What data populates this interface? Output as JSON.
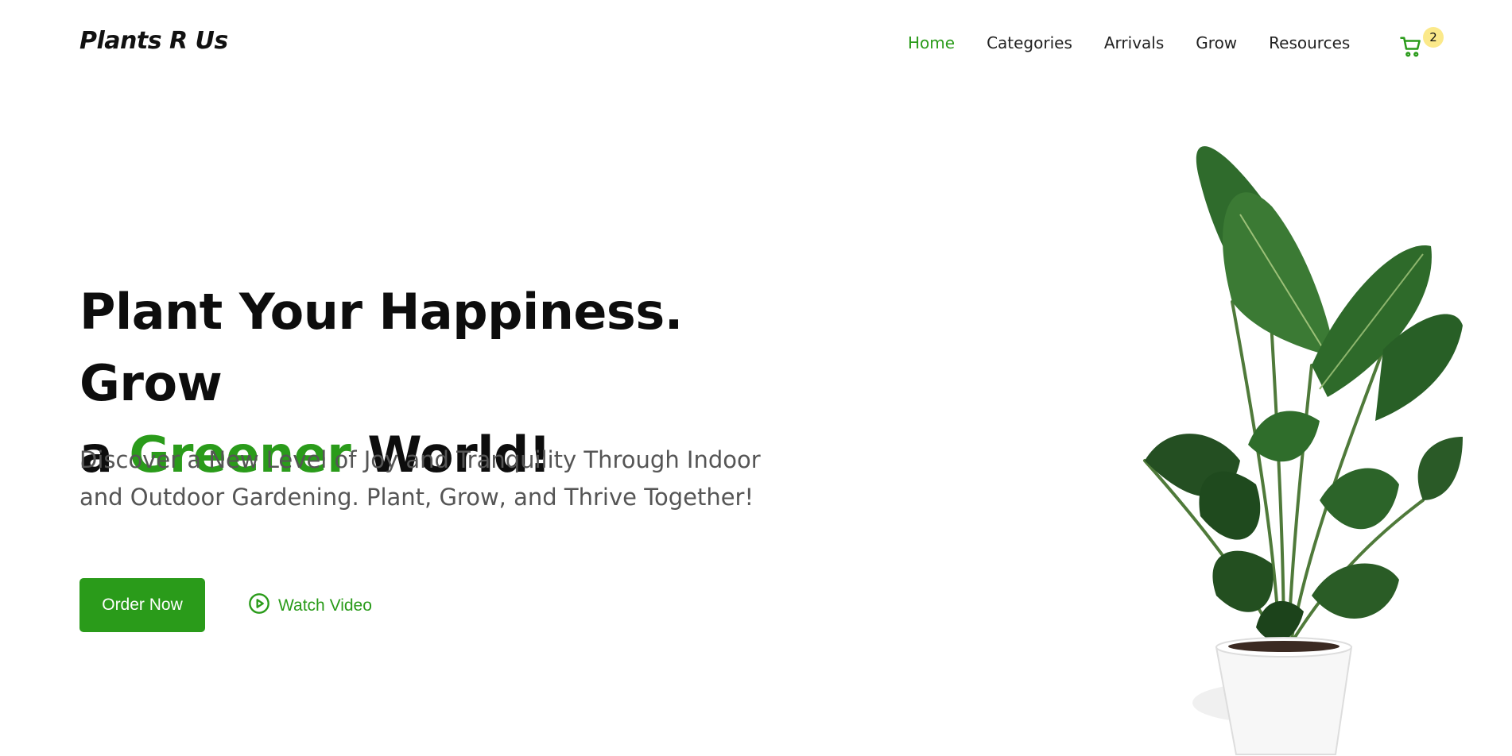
{
  "header": {
    "logo": "Plants R Us",
    "nav": [
      {
        "label": "Home",
        "active": true
      },
      {
        "label": "Categories",
        "active": false
      },
      {
        "label": "Arrivals",
        "active": false
      },
      {
        "label": "Grow",
        "active": false
      },
      {
        "label": "Resources",
        "active": false
      }
    ],
    "cart": {
      "icon": "cart-icon",
      "count": "2"
    }
  },
  "hero": {
    "title_part1": "Plant Your Happiness. Grow",
    "title_part2_prefix": "a ",
    "title_accent": "Greener",
    "title_part2_suffix": " World!",
    "subtitle": "Discover a New Level of Joy and Tranquility Through Indoor and Outdoor Gardening. Plant, Grow, and Thrive Together!",
    "order_button": "Order Now",
    "watch_video": "Watch Video",
    "watch_video_icon": "play-circle-icon",
    "image": "potted-plant-image"
  },
  "colors": {
    "accent": "#2a9b1a",
    "badge": "#fbe98a",
    "text_dark": "#0d0d0d",
    "text_muted": "#555555"
  }
}
